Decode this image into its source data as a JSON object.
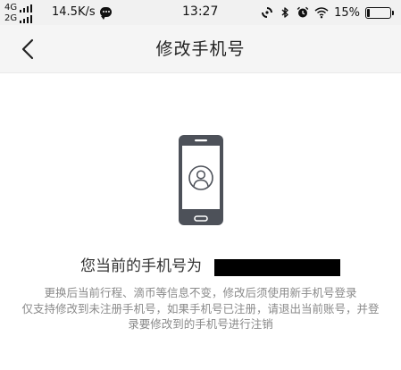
{
  "status_bar": {
    "network_top": "4G",
    "network_bottom": "2G",
    "speed": "14.5K/s",
    "time": "13:27",
    "battery_percent": "15%",
    "battery_level": 0.15
  },
  "nav": {
    "title": "修改手机号"
  },
  "content": {
    "current_number_label": "您当前的手机号为",
    "notice_1": "更换后当前行程、滴币等信息不变，修改后须使用新手机号登录",
    "notice_2": "仅支持修改到未注册手机号，如果手机号已注册，请退出当前账号，并登录要修改到的手机号进行注销"
  },
  "icons": {
    "back": "chevron-left-icon",
    "phone": "smartphone-icon",
    "avatar": "user-avatar-icon",
    "chat": "chat-bubble-icon",
    "sync": "sync-icon",
    "bluetooth": "bluetooth-icon",
    "alarm": "alarm-clock-icon",
    "wifi": "wifi-icon",
    "battery": "battery-icon"
  },
  "colors": {
    "status_bar_bg": "#f1f1f1",
    "nav_bg": "#f5f5f5",
    "phone_outline": "#4d5159",
    "text_primary": "#333333",
    "text_secondary": "#8a8a8a"
  }
}
